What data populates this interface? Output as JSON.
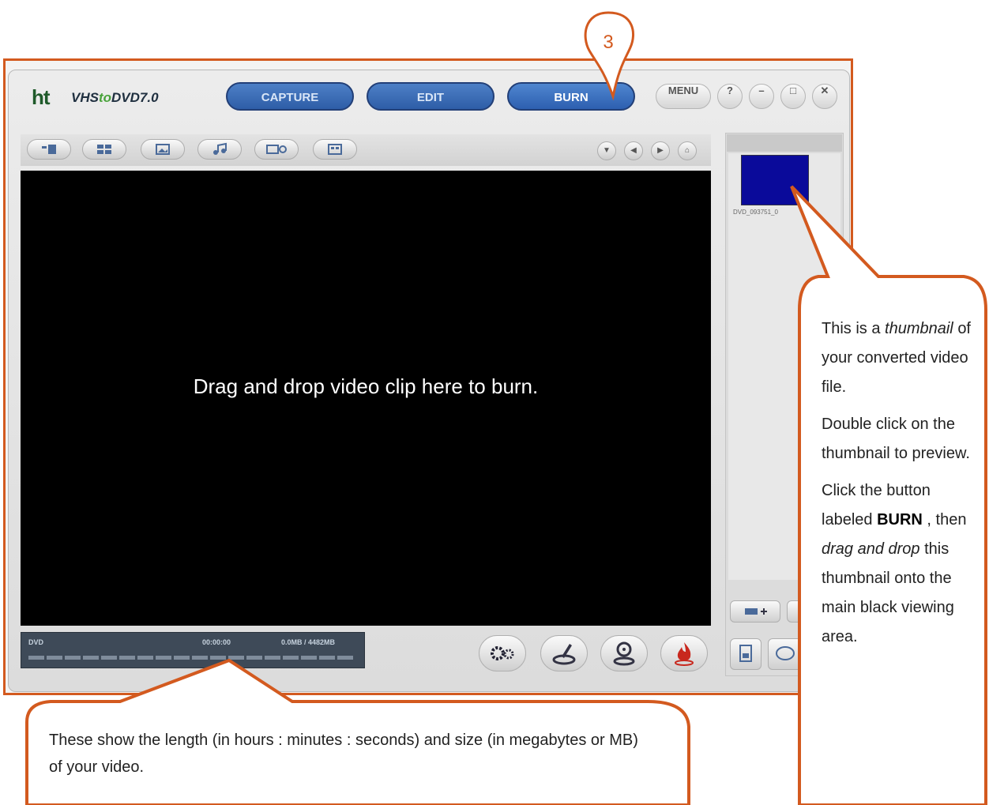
{
  "app": {
    "logo_mark": "ht",
    "logo_text_a": "VHS",
    "logo_text_b": "to",
    "logo_text_c": "DVD",
    "logo_version": "7.0"
  },
  "modes": {
    "capture": "CAPTURE",
    "edit": "EDIT",
    "burn": "BURN"
  },
  "window_controls": {
    "menu": "MENU",
    "help": "?",
    "minimize": "–",
    "maximize": "□",
    "close": "✕"
  },
  "viewer": {
    "message": "Drag and drop video clip here to burn."
  },
  "status": {
    "disc_type": "DVD",
    "length": "00:00:00",
    "size": "0.0MB / 4482MB"
  },
  "clip_panel": {
    "thumbnail_label": "DVD_093751_0",
    "thumbnail_color": "#0a0a9a"
  },
  "annotations": {
    "step_number": "3",
    "right": {
      "p1_a": "This is a",
      "p1_em": "thumbnail",
      "p1_b": "of your converted video file.",
      "p2": "Double click on the thumbnail to preview.",
      "p3_a": "Click the button labeled",
      "p3_strong": "BURN",
      "p3_b": ", then",
      "p3_em": "drag and drop",
      "p3_c": "this thumbnail onto the main black viewing area."
    },
    "bottom": "These show the length (in hours : minutes : seconds) and size (in megabytes or MB) of your video.",
    "accent_color": "#d35a1f"
  }
}
